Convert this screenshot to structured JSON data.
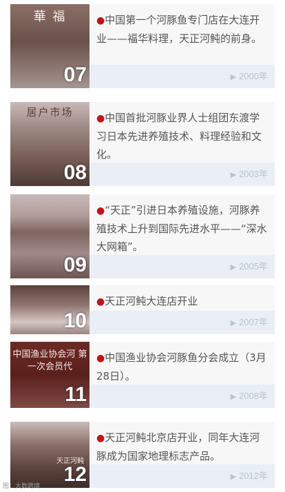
{
  "timeline": [
    {
      "number": "07",
      "text": "中国第一个河豚鱼专门店在大连开业——福华料理，天正河鲀的前身。",
      "year": "2000年",
      "sign": "華 福"
    },
    {
      "number": "08",
      "text": "中国首批河豚业界人士组团东渡学习日本先进养殖技术、料理经验和文化。",
      "year": "2003年",
      "sign": "居户市场"
    },
    {
      "number": "09",
      "text": "“天正”引进日本养殖设施，河豚养殖技术上升到国际先进水平——“深水大网箱”。",
      "year": "2005年",
      "sign": ""
    },
    {
      "number": "10",
      "text": "天正河鲀大连店开业",
      "year": "2007年",
      "sign": ""
    },
    {
      "number": "11",
      "text": "中国渔业协会河豚鱼分会成立（3月28日）。",
      "year": "2008年",
      "sign": "中国渔业协会河 第一次会员代"
    },
    {
      "number": "12",
      "text": "天正河鲀北京店开业，同年大连河豚成为国家地理标志产品。",
      "year": "2012年",
      "sign": "天正河鲀"
    }
  ],
  "watermark": "图：大数跨境",
  "colors": {
    "accent": "#c0141c",
    "bar": "#e9eff4",
    "year": "#b9c3cc"
  }
}
